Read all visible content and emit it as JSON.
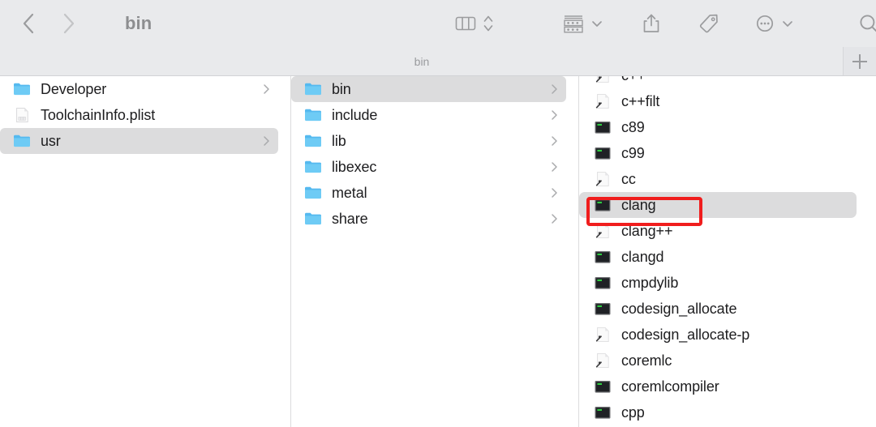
{
  "window": {
    "title": "bin"
  },
  "toolbar": {
    "back_label": "Back",
    "forward_label": "Forward",
    "title": "bin",
    "items": [
      {
        "name": "column-view-icon",
        "label": "Column View"
      },
      {
        "name": "view-stepper-icon",
        "label": "View Options Stepper"
      },
      {
        "name": "group-by-icon",
        "label": "Group By"
      },
      {
        "name": "group-by-caret-icon",
        "label": "Group By Menu"
      },
      {
        "name": "share-icon",
        "label": "Share"
      },
      {
        "name": "tag-icon",
        "label": "Tags"
      },
      {
        "name": "more-actions-icon",
        "label": "More"
      },
      {
        "name": "more-actions-caret-icon",
        "label": "More Menu"
      },
      {
        "name": "search-icon",
        "label": "Search"
      }
    ]
  },
  "tabbar": {
    "active_tab": "bin",
    "new_tab_label": "+"
  },
  "columns": [
    {
      "name": "column-1",
      "items": [
        {
          "label": "Developer",
          "icon": "folder",
          "disclosure": true,
          "selected": false
        },
        {
          "label": "ToolchainInfo.plist",
          "icon": "plist",
          "disclosure": false,
          "selected": false
        },
        {
          "label": "usr",
          "icon": "folder",
          "disclosure": true,
          "selected": true
        }
      ]
    },
    {
      "name": "column-2",
      "items": [
        {
          "label": "bin",
          "icon": "folder",
          "disclosure": true,
          "selected": true
        },
        {
          "label": "include",
          "icon": "folder",
          "disclosure": true,
          "selected": false
        },
        {
          "label": "lib",
          "icon": "folder",
          "disclosure": true,
          "selected": false
        },
        {
          "label": "libexec",
          "icon": "folder",
          "disclosure": true,
          "selected": false
        },
        {
          "label": "metal",
          "icon": "folder",
          "disclosure": true,
          "selected": false
        },
        {
          "label": "share",
          "icon": "folder",
          "disclosure": true,
          "selected": false
        }
      ]
    },
    {
      "name": "column-3",
      "items": [
        {
          "label": "c++",
          "icon": "alias",
          "disclosure": false,
          "selected": false
        },
        {
          "label": "c++filt",
          "icon": "alias",
          "disclosure": false,
          "selected": false
        },
        {
          "label": "c89",
          "icon": "executable",
          "disclosure": false,
          "selected": false
        },
        {
          "label": "c99",
          "icon": "executable",
          "disclosure": false,
          "selected": false
        },
        {
          "label": "cc",
          "icon": "alias",
          "disclosure": false,
          "selected": false
        },
        {
          "label": "clang",
          "icon": "executable",
          "disclosure": false,
          "selected": true
        },
        {
          "label": "clang++",
          "icon": "alias",
          "disclosure": false,
          "selected": false
        },
        {
          "label": "clangd",
          "icon": "executable",
          "disclosure": false,
          "selected": false
        },
        {
          "label": "cmpdylib",
          "icon": "executable",
          "disclosure": false,
          "selected": false
        },
        {
          "label": "codesign_allocate",
          "icon": "executable",
          "disclosure": false,
          "selected": false
        },
        {
          "label": "codesign_allocate-p",
          "icon": "alias",
          "disclosure": false,
          "selected": false
        },
        {
          "label": "coremlc",
          "icon": "alias",
          "disclosure": false,
          "selected": false
        },
        {
          "label": "coremlcompiler",
          "icon": "executable",
          "disclosure": false,
          "selected": false
        },
        {
          "label": "cpp",
          "icon": "executable",
          "disclosure": false,
          "selected": false
        }
      ]
    }
  ],
  "annotation": {
    "name": "highlight-box",
    "target": "clang",
    "color": "#f01d1d"
  },
  "colors": {
    "toolbar_bg": "#e9eaec",
    "content_bg": "#ffffff",
    "selection_bg": "#dcdcdd",
    "folder_blue": "#5ec1f2",
    "text": "#1d1d1f",
    "muted_text": "#8d8e90"
  }
}
